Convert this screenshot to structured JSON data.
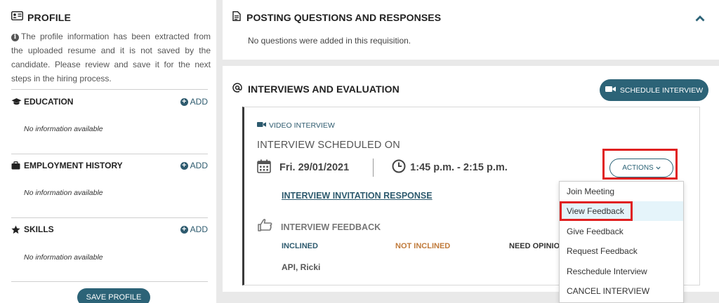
{
  "profile": {
    "title": "PROFILE",
    "info_text": "The profile information has been extracted from the uploaded resume and it is not saved by the candidate. Please review and save it for the next steps in the hiring process.",
    "sections": [
      {
        "label": "EDUCATION",
        "add_label": "ADD",
        "empty_text": "No information available",
        "icon": "graduation-cap-icon"
      },
      {
        "label": "EMPLOYMENT HISTORY",
        "add_label": "ADD",
        "empty_text": "No information available",
        "icon": "briefcase-icon"
      },
      {
        "label": "SKILLS",
        "add_label": "ADD",
        "empty_text": "No information available",
        "icon": "star-icon"
      }
    ],
    "save_label": "SAVE PROFILE"
  },
  "posting": {
    "title": "POSTING QUESTIONS AND RESPONSES",
    "empty_text": "No questions were added in this requisition."
  },
  "interviews": {
    "title": "INTERVIEWS AND EVALUATION",
    "schedule_label": "SCHEDULE INTERVIEW",
    "type_label": "VIDEO INTERVIEW",
    "scheduled_label": "INTERVIEW SCHEDULED ON",
    "date": "Fri. 29/01/2021",
    "time": "1:45 p.m. - 2:15 p.m.",
    "invitation_link": "INTERVIEW INVITATION RESPONSE",
    "feedback_title": "INTERVIEW FEEDBACK",
    "inclined": "INCLINED",
    "not_inclined": "NOT INCLINED",
    "need_opinion": "NEED OPINION",
    "interviewer": "API, Ricki",
    "actions_label": "ACTIONS"
  },
  "actions_menu": {
    "items": [
      "Join Meeting",
      "View Feedback",
      "Give Feedback",
      "Request Feedback",
      "Reschedule Interview",
      "CANCEL INTERVIEW"
    ],
    "highlighted_index": 1
  },
  "colors": {
    "primary": "#2c6377",
    "highlight_border": "#e02020",
    "not_inclined": "#c07a3a",
    "menu_hover": "#e5f4fa"
  }
}
